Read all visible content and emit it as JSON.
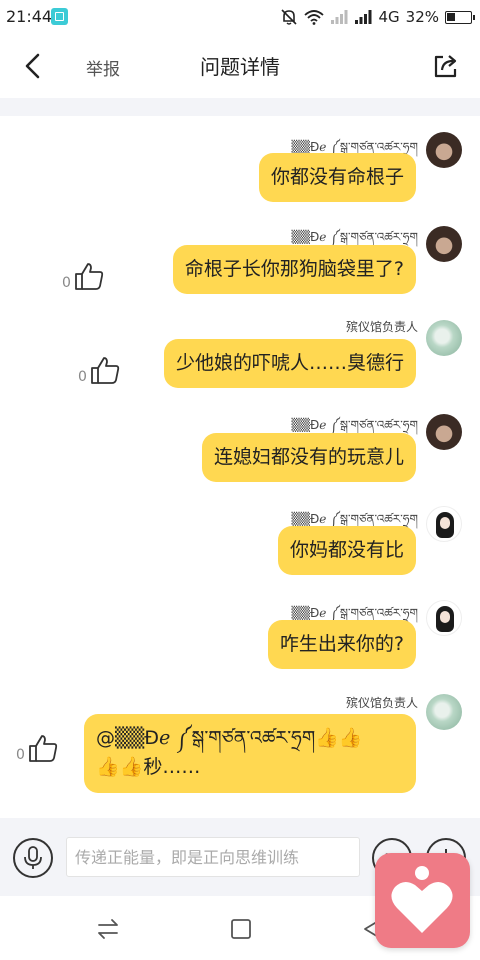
{
  "status_bar": {
    "time": "21:44",
    "network": "4G",
    "battery": "32%"
  },
  "header": {
    "report": "举报",
    "title": "问题详情"
  },
  "messages": [
    {
      "user": "▒▒Ɖℯ  ༼སྒ་གཙན་འཚར་ཧྲག",
      "text": "你都没有命根子",
      "avatar": "dark-hair-avatar"
    },
    {
      "user": "▒▒Ɖℯ  ༼སྒ་གཙན་འཚར་ཧྲག",
      "text": "命根子长你那狗脑袋里了?",
      "like_count": "0",
      "avatar": "dark-hair-avatar"
    },
    {
      "user": "殡仪馆负责人",
      "text": "少他娘的吓唬人……臭德行",
      "like_count": "0",
      "avatar": "green-avatar"
    },
    {
      "user": "▒▒Ɖℯ  ༼སྒ་གཙན་འཚར་ཧྲག",
      "text": "连媳妇都没有的玩意儿",
      "avatar": "dark-hair-avatar"
    },
    {
      "user": "▒▒Ɖℯ  ༼སྒ་གཙན་འཚར་ཧྲག",
      "text": "你妈都没有比",
      "avatar": "girl-avatar"
    },
    {
      "user": "▒▒Ɖℯ  ༼སྒ་གཙན་འཚར་ཧྲག",
      "text": "咋生出来你的?",
      "avatar": "girl-avatar"
    },
    {
      "user": "殡仪馆负责人",
      "text_line1": "@▒▒Ɖℯ  ༼སྒ་གཙན་འཚར་ཧྲག👍👍",
      "text_line2": "👍👍秒……",
      "like_count": "0",
      "avatar": "green-avatar"
    }
  ],
  "input": {
    "placeholder": "传递正能量，即是正向思维训练"
  },
  "colors": {
    "bubble": "#ffd851",
    "band": "#f3f4f8",
    "badge": "#ef7b86"
  }
}
